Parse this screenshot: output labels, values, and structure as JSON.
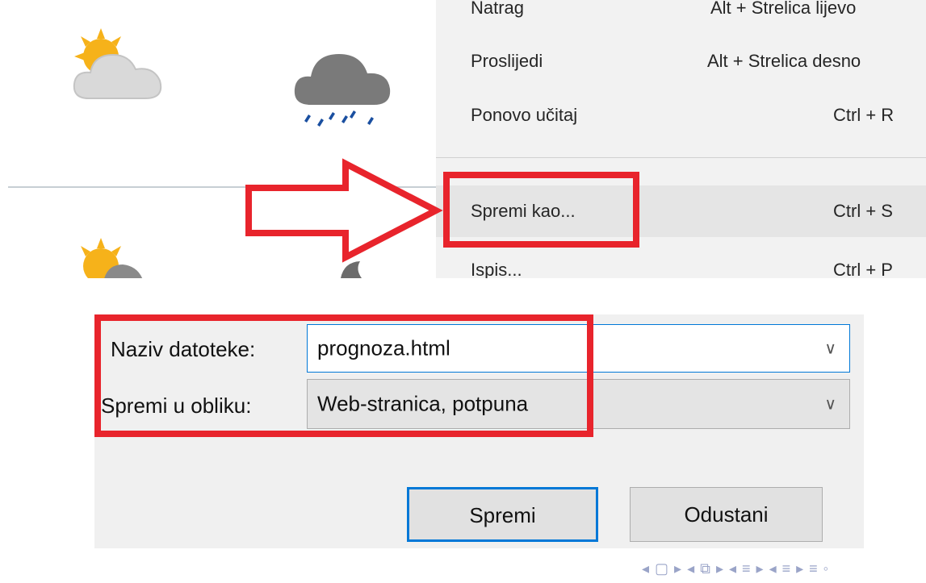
{
  "menu": {
    "items": [
      {
        "label": "Natrag",
        "shortcut": "Alt + Strelica lijevo"
      },
      {
        "label": "Proslijedi",
        "shortcut": "Alt + Strelica desno"
      },
      {
        "label": "Ponovo učitaj",
        "shortcut": "Ctrl + R"
      },
      {
        "label": "Spremi kao...",
        "shortcut": "Ctrl + S"
      },
      {
        "label": "Ispis...",
        "shortcut": "Ctrl + P"
      }
    ]
  },
  "weather": {
    "icons": [
      "sun-cloud-icon",
      "rain-cloud-icon",
      "sun-cloud-icon",
      "moon-cloud-icon"
    ]
  },
  "dialog": {
    "filename_label": "Naziv datoteke:",
    "filename_value": "prognoza.html",
    "format_label": "Spremi u obliku:",
    "format_value": "Web-stranica, potpuna",
    "save_label": "Spremi",
    "cancel_label": "Odustani"
  },
  "nav": {
    "symbols": "◂ ▢ ▸ ◂ ⧉ ▸ ◂ ≡ ▸ ◂ ≡ ▸   ≡   ◦"
  },
  "colors": {
    "annotation_red": "#e8242c",
    "focus_blue": "#0078d7",
    "menu_bg": "#f2f2f2",
    "dialog_bg": "#f0f0f0"
  }
}
